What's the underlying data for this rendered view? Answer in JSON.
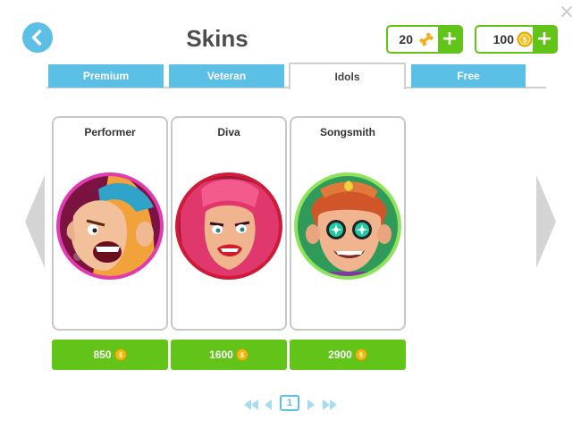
{
  "header": {
    "title": "Skins",
    "back_icon": "chevron-left-icon",
    "close_icon": "close-icon",
    "close_glyph": "×"
  },
  "currencies": [
    {
      "amount": "20",
      "icon": "bone-icon",
      "plus": "+"
    },
    {
      "amount": "100",
      "icon": "coin-icon",
      "plus": "+"
    }
  ],
  "tabs": [
    {
      "label": "Premium",
      "active": false
    },
    {
      "label": "Veteran",
      "active": false
    },
    {
      "label": "Idols",
      "active": true
    },
    {
      "label": "Free",
      "active": false
    }
  ],
  "cards": [
    {
      "name": "Performer",
      "price": "850",
      "ring_color": "#e23bb1"
    },
    {
      "name": "Diva",
      "price": "1600",
      "ring_color": "#d01a3a"
    },
    {
      "name": "Songsmith",
      "price": "2900",
      "ring_color": "#8fe35b"
    }
  ],
  "pagination": {
    "current": "1"
  },
  "colors": {
    "accent_blue": "#5bbfe6",
    "accent_green": "#62c318",
    "coin_gold": "#f3b90f"
  }
}
